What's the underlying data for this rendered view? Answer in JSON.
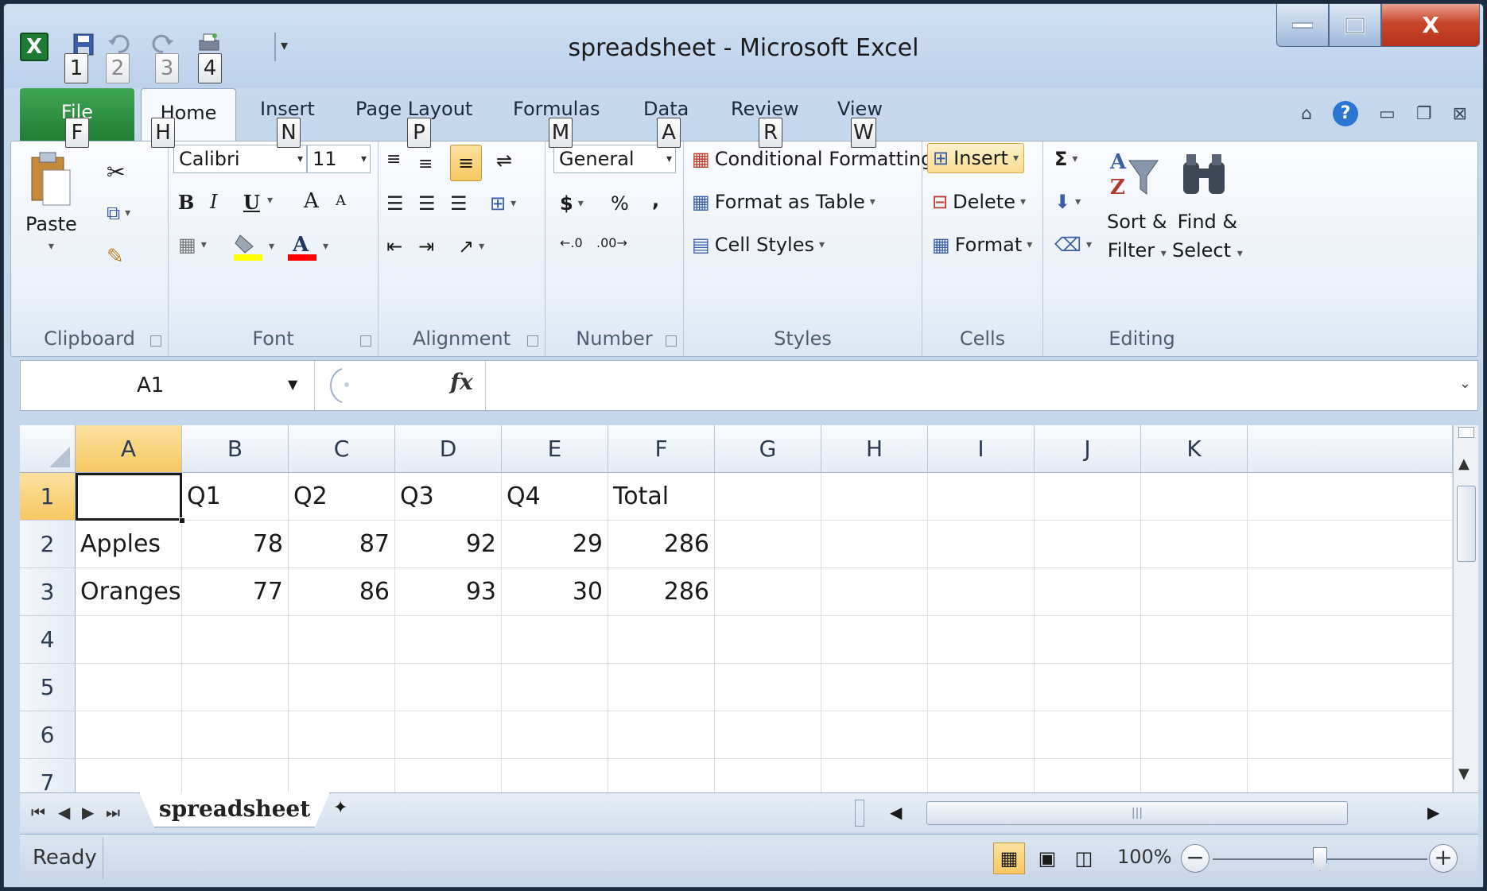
{
  "titlebar": {
    "title": "spreadsheet  -  Microsoft Excel",
    "qat_keytips": [
      "1",
      "2",
      "3",
      "4"
    ]
  },
  "tabs": {
    "file": "File",
    "home": "Home",
    "insert": "Insert",
    "page_layout": "Page Layout",
    "formulas": "Formulas",
    "data": "Data",
    "review": "Review",
    "view": "View"
  },
  "keytips": {
    "file": "F",
    "home": "H",
    "insert": "N",
    "page_layout": "P",
    "formulas": "M",
    "data": "A",
    "review": "R",
    "view": "W"
  },
  "ribbon": {
    "clipboard": {
      "paste": "Paste",
      "label": "Clipboard"
    },
    "font": {
      "name": "Calibri",
      "size": "11",
      "bold": "B",
      "italic": "I",
      "underline": "U",
      "grow": "A",
      "shrink": "A",
      "label": "Font",
      "fill_color": "#ffff00",
      "font_color": "#ff0000"
    },
    "alignment": {
      "label": "Alignment"
    },
    "number": {
      "format": "General",
      "currency": "$",
      "percent": "%",
      "comma": ",",
      "label": "Number"
    },
    "styles": {
      "conditional": "Conditional Formatting",
      "format_table": "Format as Table",
      "cell_styles": "Cell Styles",
      "label": "Styles"
    },
    "cells": {
      "insert": "Insert",
      "delete": "Delete",
      "format": "Format",
      "label": "Cells"
    },
    "editing": {
      "sum": "Σ",
      "sort": "Sort &",
      "sort2": "Filter",
      "find": "Find &",
      "find2": "Select",
      "label": "Editing"
    }
  },
  "formula_bar": {
    "name_box": "A1",
    "fx": "fx",
    "value": ""
  },
  "sheet": {
    "columns": [
      "A",
      "B",
      "C",
      "D",
      "E",
      "F",
      "G",
      "H",
      "I",
      "J",
      "K"
    ],
    "rows": [
      "1",
      "2",
      "3",
      "4",
      "5",
      "6",
      "7"
    ],
    "cells": {
      "r1": [
        "",
        "Q1",
        "Q2",
        "Q3",
        "Q4",
        "Total"
      ],
      "r2": [
        "Apples",
        "78",
        "87",
        "92",
        "29",
        "286"
      ],
      "r3": [
        "Oranges",
        "77",
        "86",
        "93",
        "30",
        "286"
      ]
    }
  },
  "sheet_tabs": {
    "active": "spreadsheet"
  },
  "status": {
    "ready": "Ready",
    "zoom": "100%",
    "zoom_percent": 100
  }
}
